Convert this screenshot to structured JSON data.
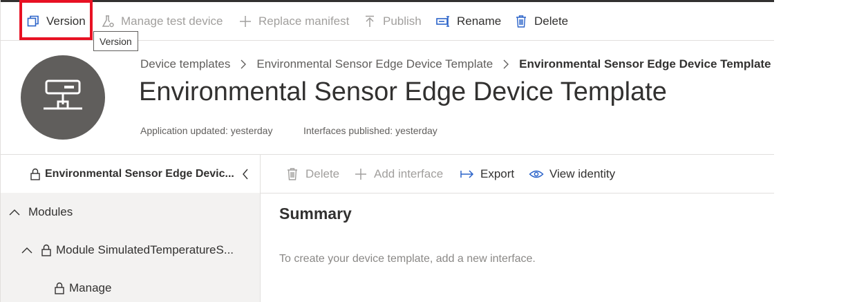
{
  "toolbar": {
    "version_label": "Version",
    "manage_test_device_label": "Manage test device",
    "replace_manifest_label": "Replace manifest",
    "publish_label": "Publish",
    "rename_label": "Rename",
    "delete_label": "Delete"
  },
  "tooltip": {
    "text": "Version"
  },
  "breadcrumb": {
    "items": [
      "Device templates",
      "Environmental Sensor Edge Device Template"
    ],
    "current": "Environmental Sensor Edge Device Template"
  },
  "header": {
    "title": "Environmental Sensor Edge Device Template",
    "app_updated": "Application updated: yesterday",
    "interfaces_published": "Interfaces published: yesterday",
    "avatar_icon": "network-device-icon"
  },
  "left_pane": {
    "header_label": "Environmental Sensor Edge Devic...",
    "tree": [
      {
        "label": "Modules"
      },
      {
        "label": "Module SimulatedTemperatureS..."
      },
      {
        "label": "Manage"
      }
    ]
  },
  "right_toolbar": {
    "delete_label": "Delete",
    "add_interface_label": "Add interface",
    "export_label": "Export",
    "view_identity_label": "View identity"
  },
  "summary": {
    "title": "Summary",
    "empty_text": "To create your device template, add a new interface."
  },
  "colors": {
    "accent": "#0078d4",
    "highlight": "#e81123",
    "disabled": "#a19f9d",
    "avatar_bg": "#605e5c"
  }
}
